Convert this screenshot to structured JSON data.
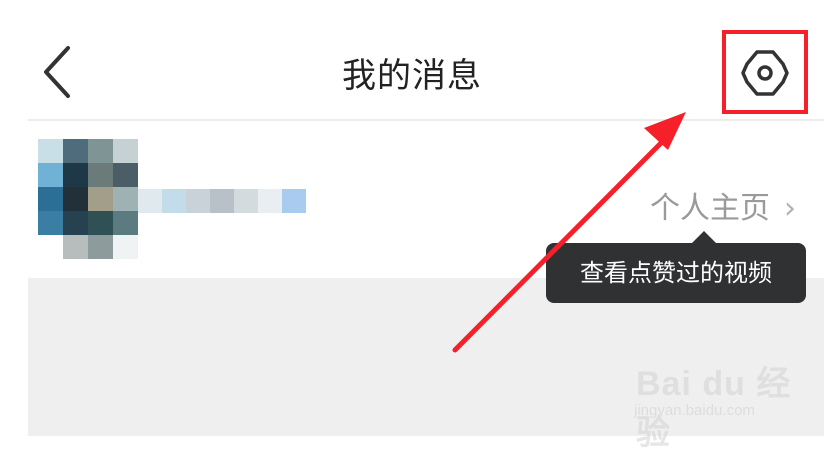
{
  "header": {
    "title": "我的消息",
    "back_icon": "chevron-left-icon",
    "settings_icon": "gear-icon"
  },
  "profile": {
    "homepage_label": "个人主页",
    "chevron": "›"
  },
  "tooltip": {
    "text": "查看点赞过的视频"
  },
  "annotation": {
    "highlight_color": "#f5202a"
  },
  "watermark": {
    "main": "Bai du 经验",
    "sub": "jingyan.baidu.com"
  }
}
